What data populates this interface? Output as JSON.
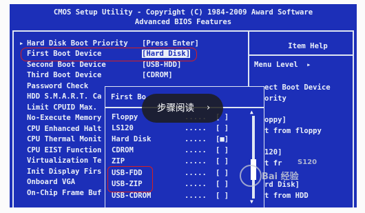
{
  "header": {
    "line1": "CMOS Setup Utility - Copyright (C) 1984-2009 Award Software",
    "line2": "Advanced BIOS Features"
  },
  "menu": {
    "arrow": "▸",
    "items": [
      {
        "label": "Hard Disk Boot Priority",
        "value": "[Press Enter]"
      },
      {
        "label": "First Boot Device",
        "value": "[Hard Disk]"
      },
      {
        "label": "Second Boot Device",
        "value": "[USB-HDD]"
      },
      {
        "label": "Third Boot Device",
        "value": "[CDROM]"
      },
      {
        "label": "Password Check",
        "value": ""
      },
      {
        "label": "HDD S.M.A.R.T. Ca",
        "value": ""
      },
      {
        "label": "Limit CPUID Max.",
        "value": ""
      },
      {
        "label": "No-Execute Memory",
        "value": ""
      },
      {
        "label": "CPU Enhanced Halt",
        "value": ""
      },
      {
        "label": "CPU Thermal Monit",
        "value": ""
      },
      {
        "label": "CPU EIST Function",
        "value": ""
      },
      {
        "label": "Virtualization Te",
        "value": ""
      },
      {
        "label": "Init Display Firs",
        "value": ""
      },
      {
        "label": "Onboard VGA",
        "value": ""
      },
      {
        "label": "On-Chip Frame Buf",
        "value": ""
      }
    ]
  },
  "help": {
    "title": "Item Help",
    "menu_level": "Menu Level",
    "menu_level_arrow": "▸",
    "lines": [
      "ect Boot Device",
      "ority",
      "oppy]",
      "t from floppy",
      "120]",
      "t fr",
      "rd Disk]",
      "t from HDD"
    ]
  },
  "popup": {
    "title": "First Bo",
    "options": [
      {
        "name": "Floppy",
        "dots": ".....",
        "box": "[ ]"
      },
      {
        "name": "LS120",
        "dots": ".....",
        "box": "[ ]"
      },
      {
        "name": "Hard Disk",
        "dots": ".....",
        "box": "[■]"
      },
      {
        "name": "CDROM",
        "dots": ".....",
        "box": "[ ]"
      },
      {
        "name": "ZIP",
        "dots": ".....",
        "box": "[ ]"
      },
      {
        "name": "USB-FDD",
        "dots": ".....",
        "box": "[ ]"
      },
      {
        "name": "USB-ZIP",
        "dots": ".....",
        "box": "[ ]"
      },
      {
        "name": "USB-CDROM",
        "dots": ".....",
        "box": "[ ]"
      }
    ],
    "scroll_up": "▲",
    "scroll_down": "▼"
  },
  "overlay": {
    "label": "步骤阅读",
    "chevron": "›"
  },
  "watermark": {
    "text": "Bai 经验",
    "sub": "S120"
  },
  "colors": {
    "bios_blue": "#1c2fb8",
    "text": "#e9eef8",
    "highlight_red": "#d62020"
  }
}
